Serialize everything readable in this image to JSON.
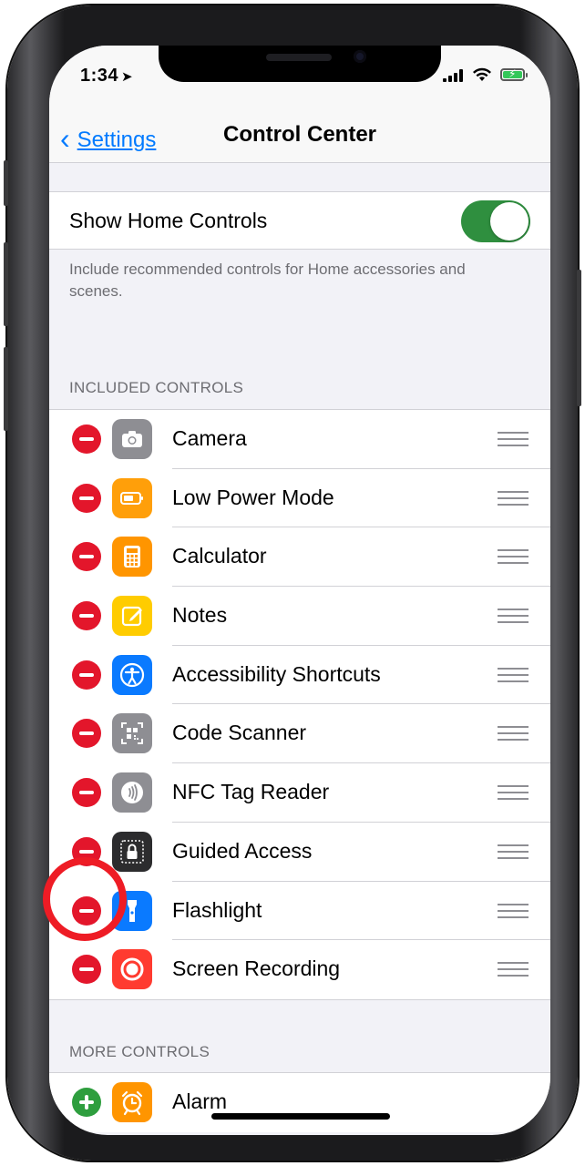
{
  "status_bar": {
    "time": "1:34",
    "location_glyph": "➤",
    "wifi_glyph": "📶"
  },
  "nav": {
    "back_label": "Settings",
    "back_chevron": "‹",
    "title": "Control Center"
  },
  "home_controls": {
    "label": "Show Home Controls",
    "toggle_on": true,
    "footnote": "Include recommended controls for Home accessories and scenes."
  },
  "included": {
    "header": "INCLUDED CONTROLS",
    "items": [
      {
        "label": "Camera",
        "icon": "camera-icon",
        "color": "#8e8e93"
      },
      {
        "label": "Low Power Mode",
        "icon": "battery-icon",
        "color": "#ff9f0a"
      },
      {
        "label": "Calculator",
        "icon": "calculator-icon",
        "color": "#ff9500"
      },
      {
        "label": "Notes",
        "icon": "notes-icon",
        "color": "#ffcc00"
      },
      {
        "label": "Accessibility Shortcuts",
        "icon": "accessibility-icon",
        "color": "#0a7aff"
      },
      {
        "label": "Code Scanner",
        "icon": "qr-code-icon",
        "color": "#8e8e93"
      },
      {
        "label": "NFC Tag Reader",
        "icon": "nfc-icon",
        "color": "#8e8e93"
      },
      {
        "label": "Guided Access",
        "icon": "lock-icon",
        "color": "#2c2c2e"
      },
      {
        "label": "Flashlight",
        "icon": "flashlight-icon",
        "color": "#0a7aff"
      },
      {
        "label": "Screen Recording",
        "icon": "record-icon",
        "color": "#ff3b30"
      }
    ]
  },
  "more": {
    "header": "MORE CONTROLS",
    "items": [
      {
        "label": "Alarm",
        "icon": "alarm-icon",
        "color": "#ff9500"
      }
    ]
  },
  "colors": {
    "accent": "#007aff",
    "delete": "#e3162b",
    "add": "#2e9e3e",
    "highlight_circle": "#ee1c25"
  }
}
